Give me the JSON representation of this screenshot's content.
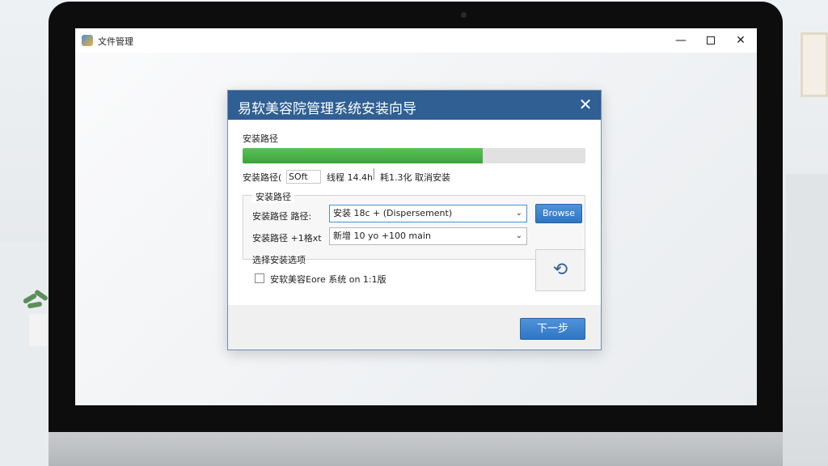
{
  "window": {
    "title": "文件管理",
    "minimize_glyph": "—",
    "close_glyph": "✕"
  },
  "dialog": {
    "title": "易软美容院管理系统安装向导",
    "close_glyph": "✕",
    "section_label": "安装路径",
    "progress_percent": 70,
    "status_prefix": "安装路径(",
    "status_value": "SOft",
    "status_mid": "线程 14.4h",
    "status_right": "耗1.3化  取消安装"
  },
  "install_group": {
    "title": "安装路径",
    "row1_label": "安装路径  路径:",
    "row1_value": "安装 18c + (Dispersement)",
    "row2_label": "安装路径  +1格xt",
    "row2_value": "新增 10 yo +100 main",
    "browse_label": "Browse",
    "refresh_glyph": "⟲"
  },
  "options": {
    "title": "选择安装选项",
    "checkbox_label": "安软美容Eore 系统 on 1:1版",
    "checked": false
  },
  "footer": {
    "next_label": "下一步"
  },
  "colors": {
    "dialog_header": "#2f5f93",
    "progress_fill": "#3aa33a",
    "button_blue": "#2f76c4"
  }
}
